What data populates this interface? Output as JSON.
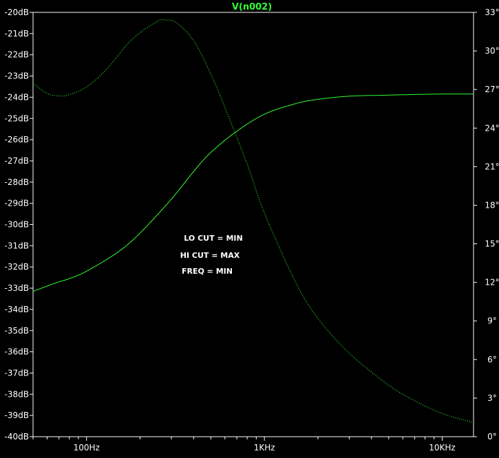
{
  "chart_data": {
    "type": "line",
    "title": "V(n002)",
    "x_scale": "log",
    "xlim": [
      50,
      15000
    ],
    "x_ticks": [
      {
        "value": 100,
        "label": "100Hz"
      },
      {
        "value": 1000,
        "label": "1KHz"
      },
      {
        "value": 10000,
        "label": "10KHz"
      }
    ],
    "y_left": {
      "unit": "dB",
      "ylim": [
        -40,
        -20
      ],
      "ticks": [
        "-20dB",
        "-21dB",
        "-22dB",
        "-23dB",
        "-24dB",
        "-25dB",
        "-26dB",
        "-27dB",
        "-28dB",
        "-29dB",
        "-30dB",
        "-31dB",
        "-32dB",
        "-33dB",
        "-34dB",
        "-35dB",
        "-36dB",
        "-37dB",
        "-38dB",
        "-39dB",
        "-40dB"
      ],
      "tick_values": [
        -20,
        -21,
        -22,
        -23,
        -24,
        -25,
        -26,
        -27,
        -28,
        -29,
        -30,
        -31,
        -32,
        -33,
        -34,
        -35,
        -36,
        -37,
        -38,
        -39,
        -40
      ]
    },
    "y_right": {
      "unit": "°",
      "ylim": [
        0,
        33
      ],
      "ticks": [
        "33°",
        "30°",
        "27°",
        "24°",
        "21°",
        "18°",
        "15°",
        "12°",
        "9°",
        "6°",
        "3°",
        "0°"
      ],
      "tick_values": [
        33,
        30,
        27,
        24,
        21,
        18,
        15,
        12,
        9,
        6,
        3,
        0
      ]
    },
    "series": [
      {
        "kind": "magnitude",
        "axis": "left",
        "style": "solid",
        "color": "#33ff33",
        "x": [
          50,
          60,
          70,
          80,
          100,
          150,
          200,
          300,
          400,
          500,
          700,
          1000,
          1500,
          2000,
          3000,
          5000,
          7000,
          10000,
          15000
        ],
        "y": [
          -33.15,
          -32.9,
          -32.7,
          -32.55,
          -32.2,
          -31.3,
          -30.4,
          -28.8,
          -27.5,
          -26.6,
          -25.6,
          -24.8,
          -24.3,
          -24.1,
          -23.95,
          -23.9,
          -23.87,
          -23.85,
          -23.85
        ]
      },
      {
        "kind": "phase",
        "axis": "right",
        "style": "dotted",
        "color": "#33ff33",
        "x": [
          50,
          60,
          70,
          80,
          100,
          130,
          180,
          250,
          280,
          320,
          400,
          500,
          600,
          800,
          1000,
          1500,
          2000,
          3000,
          5000,
          7000,
          10000,
          15000
        ],
        "y": [
          27.5,
          26.7,
          26.5,
          26.6,
          27.2,
          28.6,
          30.9,
          32.3,
          32.4,
          32.2,
          30.8,
          28.2,
          25.6,
          21.2,
          17.4,
          12.0,
          9.2,
          6.5,
          4.0,
          2.8,
          1.8,
          1.1
        ]
      }
    ],
    "annotations": [
      "LO CUT = MIN",
      "HI CUT = MAX",
      "FREQ = MIN"
    ],
    "grid": false,
    "colors": {
      "background": "#000000",
      "frame": "#ffffff",
      "trace": "#33ff33",
      "title": "#33ff33",
      "text": "#ffffff"
    }
  }
}
